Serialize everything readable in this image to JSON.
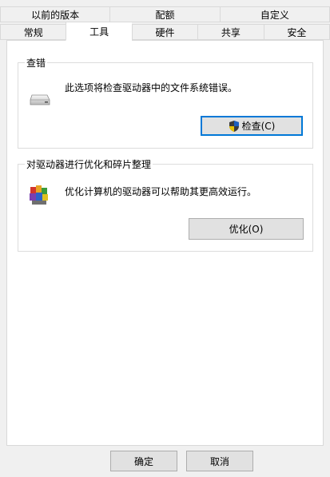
{
  "tabs_back": [
    "以前的版本",
    "配额",
    "自定义"
  ],
  "tabs_front": [
    "常规",
    "工具",
    "硬件",
    "共享",
    "安全"
  ],
  "active_tab": "工具",
  "error_check": {
    "title": "查错",
    "description": "此选项将检查驱动器中的文件系统错误。",
    "button": "检查(C)",
    "icon": "drive-icon",
    "button_icon": "uac-shield-icon"
  },
  "optimize": {
    "title": "对驱动器进行优化和碎片整理",
    "description": "优化计算机的驱动器可以帮助其更高效运行。",
    "button": "优化(O)",
    "icon": "defrag-icon"
  },
  "footer": {
    "ok": "确定",
    "cancel": "取消"
  },
  "colors": {
    "accent": "#0078d7",
    "panel_bg": "#ffffff",
    "window_bg": "#f0f0f0"
  }
}
